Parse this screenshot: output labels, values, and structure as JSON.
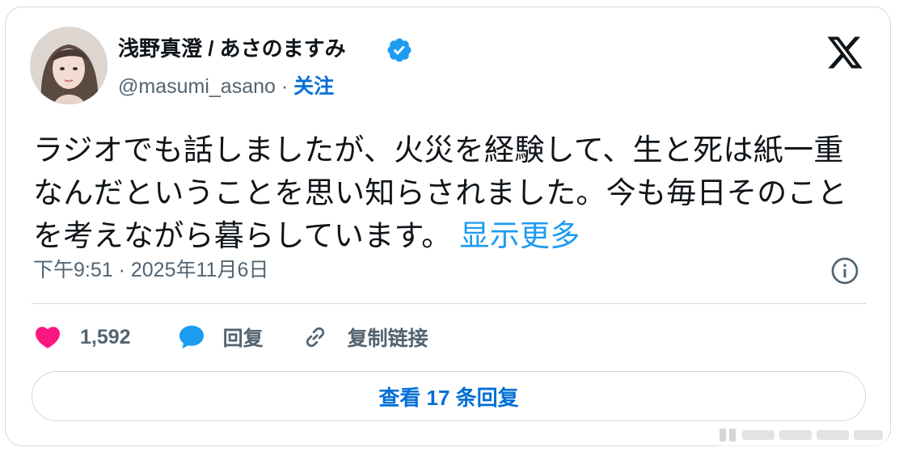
{
  "author": {
    "display_name": "浅野真澄 / あさのますみ",
    "handle": "@masumi_asano",
    "separator": "·",
    "follow_label": "关注"
  },
  "tweet": {
    "text": "ラジオでも話しましたが、火災を経験して、生と死は紙一重なんだということを思い知らされました。今も毎日そのことを考えながら暮らしています。",
    "show_more_label": "显示更多"
  },
  "meta": {
    "timestamp": "下午9:51 · 2025年11月6日"
  },
  "actions": {
    "like_count": "1,592",
    "reply_label": "回复",
    "copy_link_label": "复制链接"
  },
  "footer": {
    "view_replies_label": "查看 17 条回复"
  },
  "colors": {
    "link": "#1d9bf0",
    "follow": "#006fd6",
    "like": "#f91880",
    "reply": "#1d9bf0",
    "muted": "#536471",
    "border": "#cfd9de"
  },
  "icons": {
    "verified": "verified-badge-icon",
    "brand": "x-logo-icon",
    "info": "info-icon",
    "like": "heart-icon",
    "reply": "speech-bubble-icon",
    "copy_link": "link-icon"
  }
}
